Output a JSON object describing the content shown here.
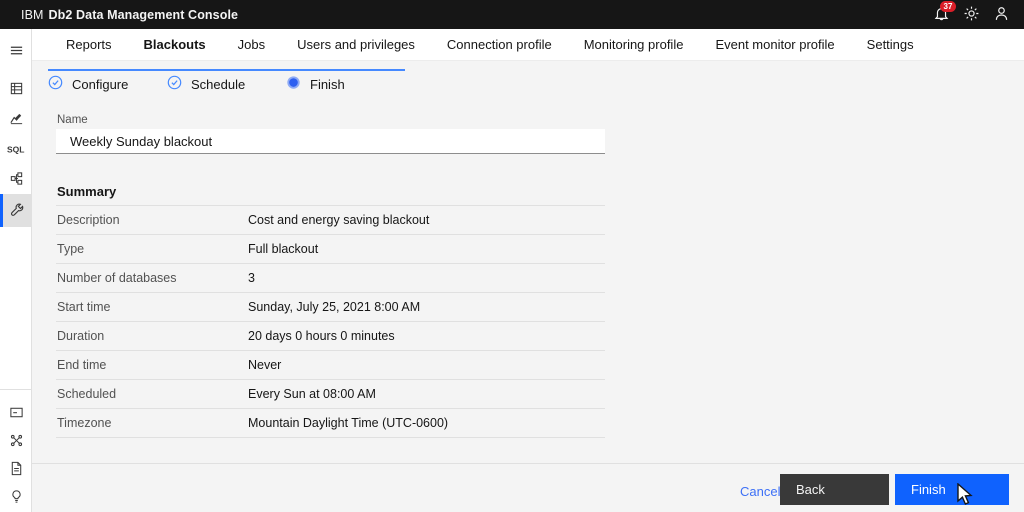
{
  "colors": {
    "header_bg": "#161616",
    "accent_blue": "#0f62fe",
    "step_blue": "#4589ff",
    "badge_red": "#da1e28",
    "content_bg": "#f4f4f4",
    "back_button_bg": "#393939"
  },
  "header": {
    "brand_prefix": "IBM",
    "brand_name": "Db2 Data Management Console",
    "notification_count": "37",
    "icons": [
      "notifications-bell-icon",
      "theme-toggle-sun-icon",
      "user-avatar-icon"
    ]
  },
  "sidebar": {
    "top_icons": [
      "menu-hamburger-icon",
      "databases-table-icon",
      "monitoring-chart-icon",
      "sql-editor-icon",
      "data-tree-icon",
      "administration-wrench-icon"
    ],
    "active_icon": "administration-wrench-icon",
    "bottom_icons": [
      "console-window-icon",
      "connections-network-icon",
      "document-icon",
      "idea-lightbulb-icon"
    ]
  },
  "nav_tabs": [
    {
      "label": "Reports",
      "active": false
    },
    {
      "label": "Blackouts",
      "active": true
    },
    {
      "label": "Jobs",
      "active": false
    },
    {
      "label": "Users and privileges",
      "active": false
    },
    {
      "label": "Connection profile",
      "active": false
    },
    {
      "label": "Monitoring profile",
      "active": false
    },
    {
      "label": "Event monitor profile",
      "active": false
    },
    {
      "label": "Settings",
      "active": false
    }
  ],
  "wizard": {
    "steps": [
      {
        "label": "Configure",
        "state": "complete"
      },
      {
        "label": "Schedule",
        "state": "complete"
      },
      {
        "label": "Finish",
        "state": "current"
      }
    ],
    "name_field": {
      "label": "Name",
      "value": "Weekly Sunday blackout"
    },
    "summary": {
      "title": "Summary",
      "rows": [
        {
          "label": "Description",
          "value": "Cost and energy saving blackout"
        },
        {
          "label": "Type",
          "value": "Full blackout"
        },
        {
          "label": "Number of databases",
          "value": "3"
        },
        {
          "label": "Start time",
          "value": "Sunday, July 25, 2021 8:00 AM"
        },
        {
          "label": "Duration",
          "value": "20 days 0 hours 0 minutes"
        },
        {
          "label": "End time",
          "value": "Never"
        },
        {
          "label": "Scheduled",
          "value": "Every Sun at 08:00 AM"
        },
        {
          "label": "Timezone",
          "value": "Mountain Daylight Time (UTC-0600)"
        }
      ]
    }
  },
  "footer": {
    "cancel_label": "Cancel",
    "back_label": "Back",
    "finish_label": "Finish"
  }
}
